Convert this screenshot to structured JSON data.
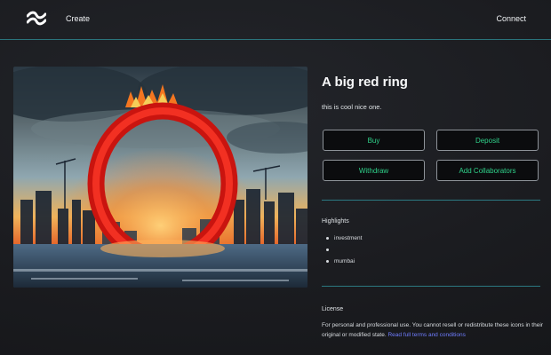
{
  "header": {
    "logo_icon": "wave-logo-icon",
    "nav_create": "Create",
    "nav_connect": "Connect"
  },
  "item": {
    "title": "A big red ring",
    "description": "this is cool nice one.",
    "image_icon": "artwork-image"
  },
  "actions": {
    "buy": "Buy",
    "deposit": "Deposit",
    "withdraw": "Withdraw",
    "add_collaborators": "Add Collaborators"
  },
  "highlights": {
    "title": "Highlights",
    "items": [
      "investment",
      "",
      "mumbai"
    ]
  },
  "license": {
    "title": "License",
    "text": "For personal and professional use. You cannot resell or redistribute these icons in their original or modified state.",
    "link": "Read full terms and conditions"
  },
  "colors": {
    "accent_green": "#2fd28a",
    "divider_teal": "#2f8a93",
    "link_blue": "#6f7dff",
    "background": "#1b1c20"
  }
}
